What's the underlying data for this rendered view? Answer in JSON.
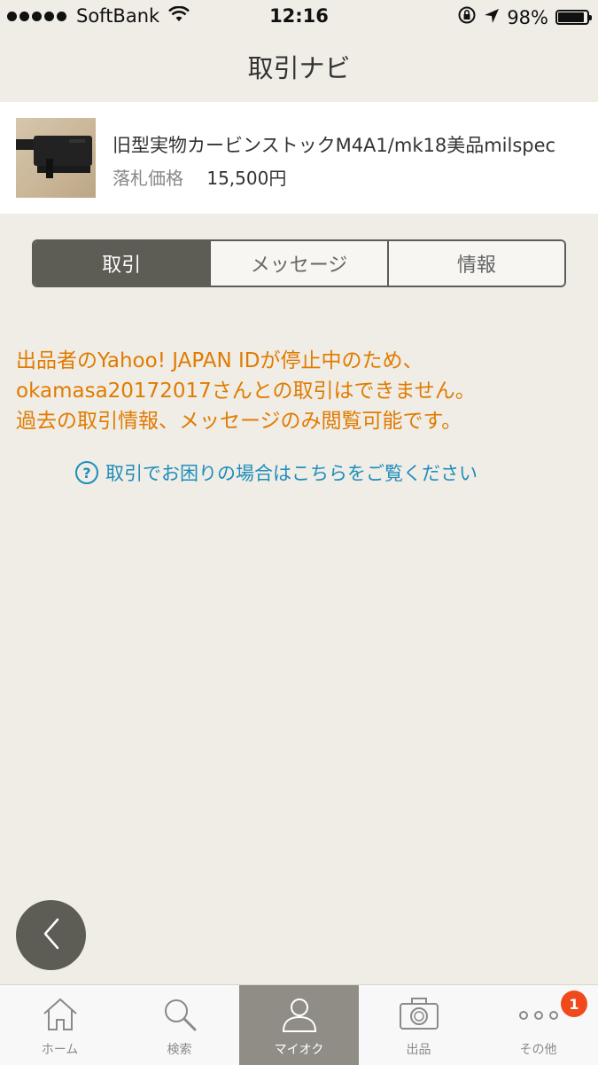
{
  "status_bar": {
    "carrier": "SoftBank",
    "time": "12:16",
    "battery": "98%",
    "battery_level": 0.98
  },
  "header": {
    "title": "取引ナビ"
  },
  "item": {
    "title": "旧型実物カービンストックM4A1/mk18美品milspec",
    "price_label": "落札価格",
    "price_value": "15,500円"
  },
  "tabs": [
    {
      "label": "取引",
      "active": true
    },
    {
      "label": "メッセージ",
      "active": false
    },
    {
      "label": "情報",
      "active": false
    }
  ],
  "notice": {
    "lines": [
      "出品者のYahoo! JAPAN IDが停止中のため、",
      "okamasa20172017さんとの取引はできません。",
      "過去の取引情報、メッセージのみ閲覧可能です。"
    ]
  },
  "help": {
    "icon": "question-circle-icon",
    "label": "取引でお困りの場合はこちらをご覧ください"
  },
  "back_button": {
    "icon": "chevron-left-icon"
  },
  "tab_bar": {
    "items": [
      {
        "label": "ホーム",
        "icon": "home-icon",
        "active": false
      },
      {
        "label": "検索",
        "icon": "search-icon",
        "active": false
      },
      {
        "label": "マイオク",
        "icon": "person-icon",
        "active": true
      },
      {
        "label": "出品",
        "icon": "camera-icon",
        "active": false
      },
      {
        "label": "その他",
        "icon": "more-icon",
        "active": false,
        "badge": "1"
      }
    ]
  },
  "colors": {
    "background": "#efede6",
    "notice": "#e17b00",
    "link": "#1f8dbd",
    "tab_active": "#5d5c55",
    "badge": "#f04a1c"
  }
}
